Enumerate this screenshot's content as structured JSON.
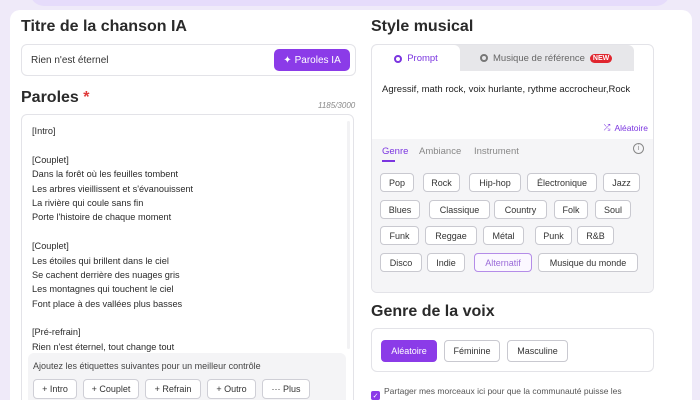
{
  "title_section": {
    "heading": "Titre de la chanson IA",
    "value": "Rien n'est éternel",
    "ai_button": "Paroles IA"
  },
  "lyrics_section": {
    "heading": "Paroles",
    "required_mark": "*",
    "counter": "1185/3000",
    "lines": [
      "[Intro]",
      "",
      "[Couplet]",
      "Dans la forêt où les feuilles tombent",
      "Les arbres vieillissent et s'évanouissent",
      "La rivière qui coule sans fin",
      "Porte l'histoire de chaque moment",
      "",
      "[Couplet]",
      "Les étoiles qui brillent dans le ciel",
      "Se cachent derrière des nuages gris",
      "Les montagnes qui touchent le ciel",
      "Font place à des vallées plus basses",
      "",
      "[Pré-refrain]",
      "Rien n'est éternel, tout change tout"
    ],
    "tags_hint": "Ajoutez les étiquettes suivantes pour un meilleur contrôle",
    "tags": [
      "+ Intro",
      "+ Couplet",
      "+ Refrain",
      "+ Outro",
      "··· Plus"
    ]
  },
  "style_section": {
    "heading": "Style musical",
    "tabs": {
      "prompt": "Prompt",
      "reference": "Musique de référence",
      "new_badge": "NEW"
    },
    "prompt_text": "Agressif, math rock, voix hurlante, rythme accrocheur,Rock",
    "random_label": "Aléatoire",
    "genre_tabs": [
      "Genre",
      "Ambiance",
      "Instrument"
    ],
    "genres": [
      "Pop",
      "Rock",
      "Hip-hop",
      "Électronique",
      "Jazz",
      "Blues",
      "Classique",
      "Country",
      "Folk",
      "Soul",
      "Funk",
      "Reggae",
      "Métal",
      "Punk",
      "R&B",
      "Disco",
      "Indie",
      "Alternatif",
      "Musique du monde"
    ],
    "selected_genre": "Alternatif"
  },
  "voice_section": {
    "heading": "Genre de la voix",
    "options": [
      "Aléatoire",
      "Féminine",
      "Masculine"
    ],
    "selected": "Aléatoire"
  },
  "share": {
    "text": "Partager mes morceaux ici pour que la communauté puisse les",
    "checked": true
  },
  "colors": {
    "accent": "#8b3be8",
    "page_bg": "#efeaf9",
    "badge": "#e0262f"
  },
  "icons": [
    "sparkle-icon",
    "radio-icon",
    "shuffle-icon",
    "info-icon",
    "check-icon"
  ]
}
